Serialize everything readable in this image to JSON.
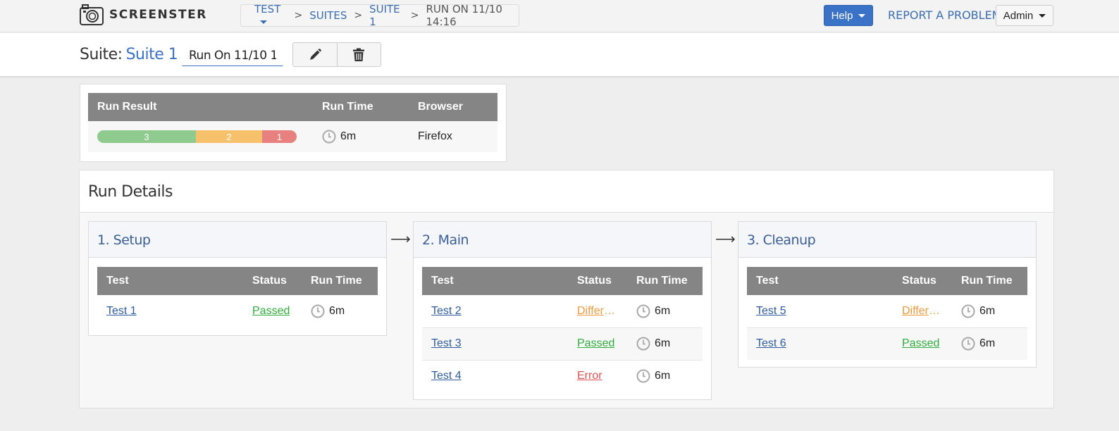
{
  "app": {
    "name": "SCREENSTER"
  },
  "breadcrumb": {
    "items": [
      {
        "label": "TEST"
      },
      {
        "label": "SUITES"
      },
      {
        "label": "SUITE 1"
      },
      {
        "label": "RUN ON 11/10 14:16"
      }
    ],
    "separator": ">"
  },
  "topnav": {
    "help_label": "Help",
    "report_label": "REPORT A PROBLEM",
    "user_label": "Admin"
  },
  "suite": {
    "prefix": "Suite:",
    "name": "Suite 1",
    "run_name": "Run On 11/10 14:16"
  },
  "summary": {
    "headers": {
      "result": "Run Result",
      "time": "Run Time",
      "browser": "Browser"
    },
    "counts": {
      "passed": "3",
      "differences": "2",
      "errors": "1"
    },
    "run_time": "6m",
    "browser": "Firefox"
  },
  "details": {
    "title": "Run Details",
    "column_headers": {
      "test": "Test",
      "status": "Status",
      "time": "Run Time"
    },
    "stages": [
      {
        "title": "1. Setup",
        "rows": [
          {
            "test": "Test 1",
            "status": "Passed",
            "time": "6m"
          }
        ]
      },
      {
        "title": "2. Main",
        "rows": [
          {
            "test": "Test 2",
            "status": "Differences",
            "time": "6m"
          },
          {
            "test": "Test 3",
            "status": "Passed",
            "time": "6m"
          },
          {
            "test": "Test 4",
            "status": "Error",
            "time": "6m"
          }
        ]
      },
      {
        "title": "3. Cleanup",
        "rows": [
          {
            "test": "Test 5",
            "status": "Differences",
            "time": "6m"
          },
          {
            "test": "Test 6",
            "status": "Passed",
            "time": "6m"
          }
        ]
      }
    ]
  },
  "colors": {
    "accent": "#3a72c7",
    "passed": "#2fae3d",
    "differences": "#ef9a3d",
    "error": "#e05252"
  }
}
